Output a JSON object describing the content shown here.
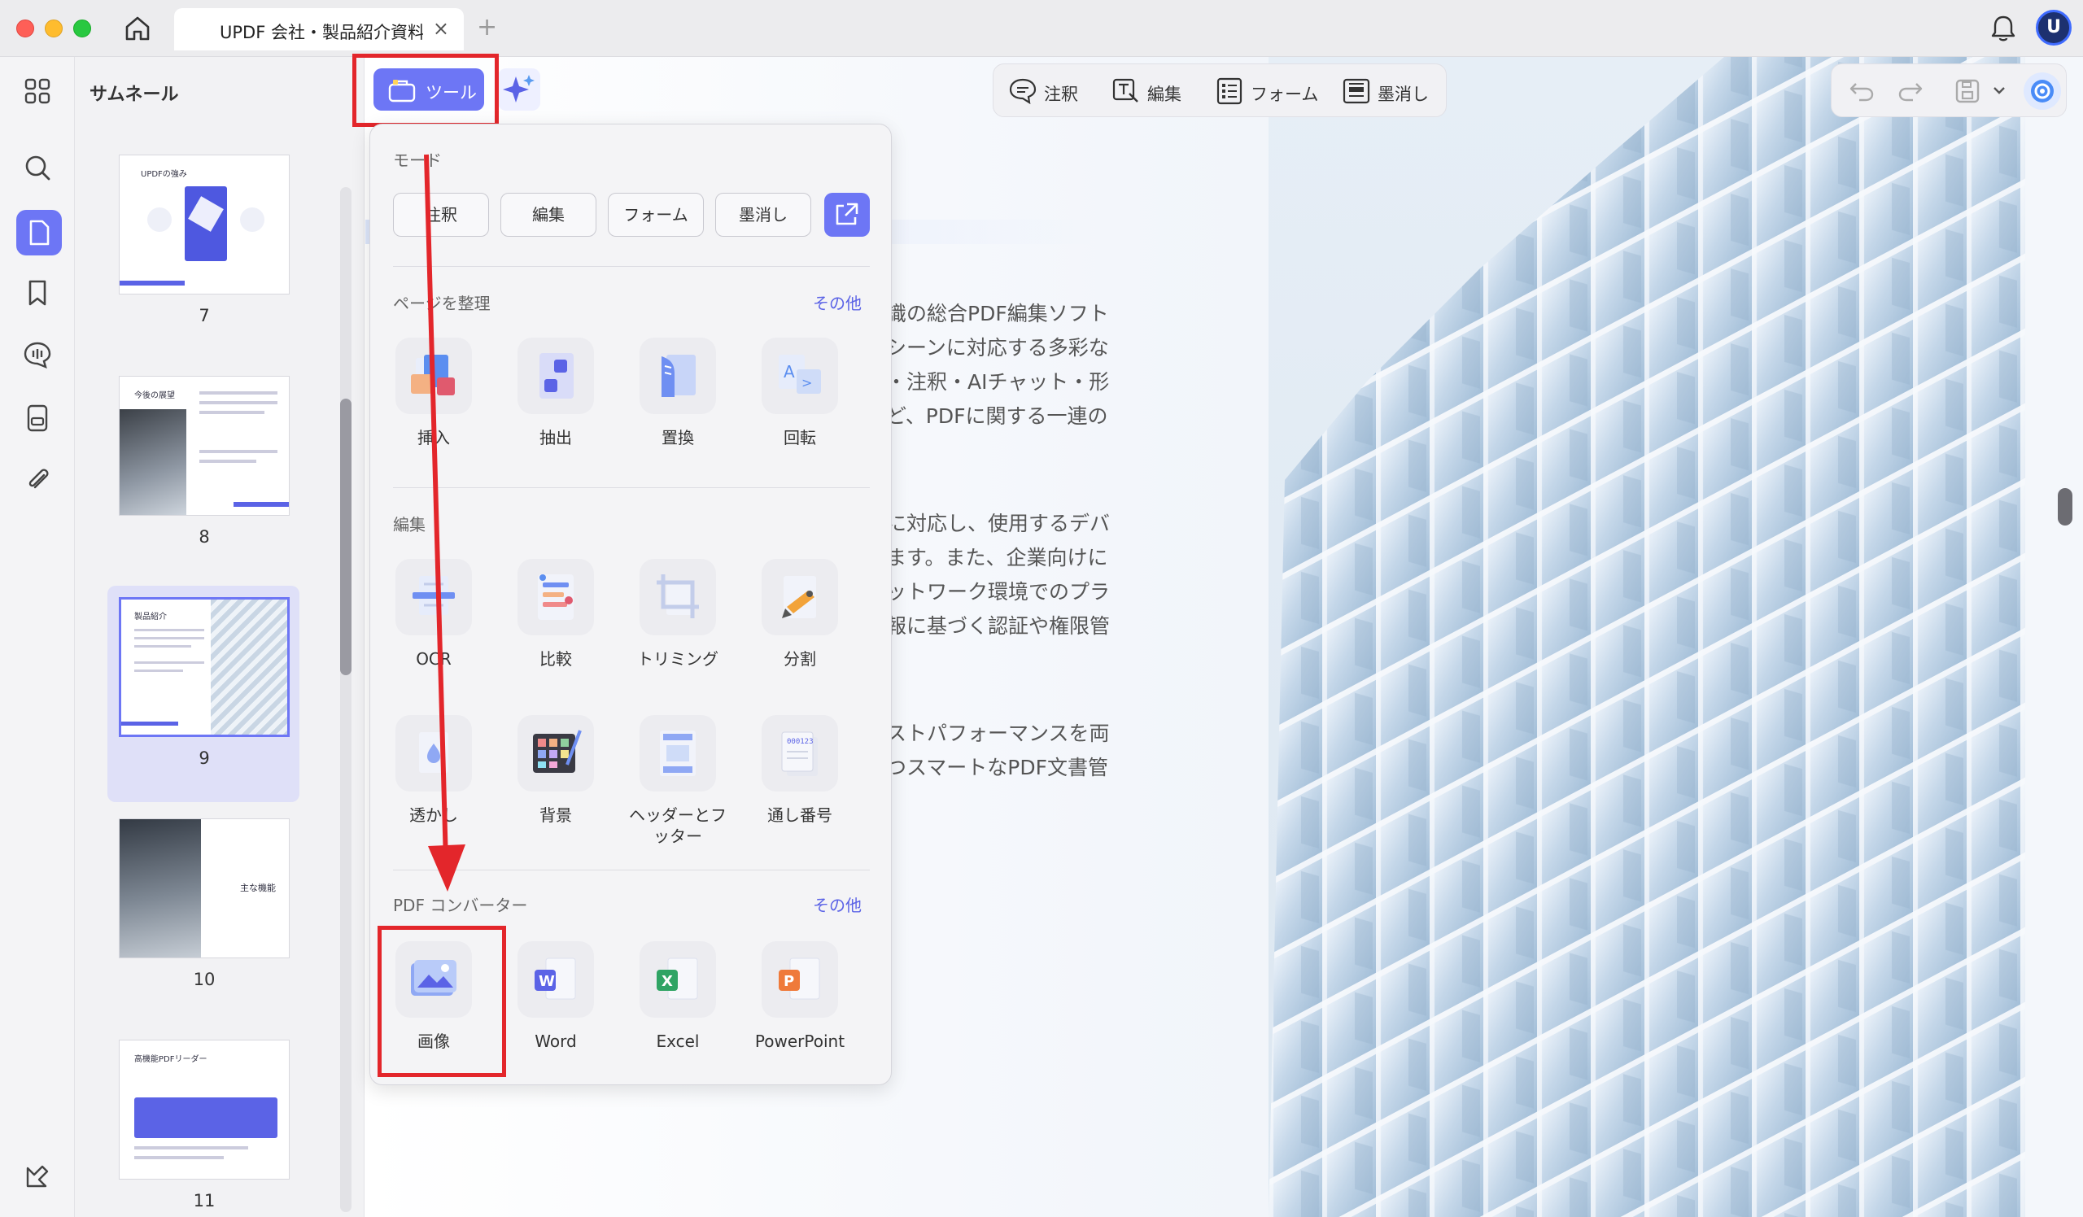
{
  "window": {
    "tab_title": "UPDF 会社・製品紹介資料",
    "tab_close": "×",
    "tab_add": "+"
  },
  "thumbnails": {
    "title": "サムネール",
    "pages": [
      {
        "number": "7",
        "heading": "UPDFの強み",
        "selected": false
      },
      {
        "number": "8",
        "heading": "今後の展望",
        "selected": false
      },
      {
        "number": "9",
        "heading": "製品紹介",
        "selected": true
      },
      {
        "number": "10",
        "heading": "主な機能",
        "selected": false
      },
      {
        "number": "11",
        "heading": "高機能PDFリーダー",
        "selected": false
      }
    ]
  },
  "toolbar": {
    "tools_label": "ツール",
    "modes": [
      {
        "label": "注釈",
        "icon": "comment-icon"
      },
      {
        "label": "編集",
        "icon": "edit-text-icon"
      },
      {
        "label": "フォーム",
        "icon": "form-icon"
      },
      {
        "label": "墨消し",
        "icon": "redact-icon"
      }
    ]
  },
  "popup": {
    "mode_title": "モード",
    "mode_buttons": [
      "注釈",
      "編集",
      "フォーム",
      "墨消し"
    ],
    "organize": {
      "title": "ページを整理",
      "more": "その他",
      "items": [
        "挿入",
        "抽出",
        "置換",
        "回転"
      ]
    },
    "edit": {
      "title": "編集",
      "items": [
        "OCR",
        "比較",
        "トリミング",
        "分割",
        "透かし",
        "背景",
        "ヘッダーとフッター",
        "通し番号"
      ]
    },
    "converter": {
      "title": "PDF コンバーター",
      "more": "その他",
      "items": [
        "画像",
        "Word",
        "Excel",
        "PowerPoint"
      ]
    }
  },
  "document": {
    "lines": [
      "識の総合PDF編集ソフト",
      "シーンに対応する多彩な",
      "・注釈・AIチャット・形",
      "ど、PDFに関する一連の",
      "に対応し、使用するデバ",
      "ます。また、企業向けに",
      "ットワーク環境でのプラ",
      "報に基づく認証や権限管",
      "ストパフォーマンスを両",
      "つスマートなPDF文書管"
    ]
  },
  "colors": {
    "accent": "#6d76f5",
    "highlight_box": "#e3262b",
    "link": "#5b63e6"
  }
}
